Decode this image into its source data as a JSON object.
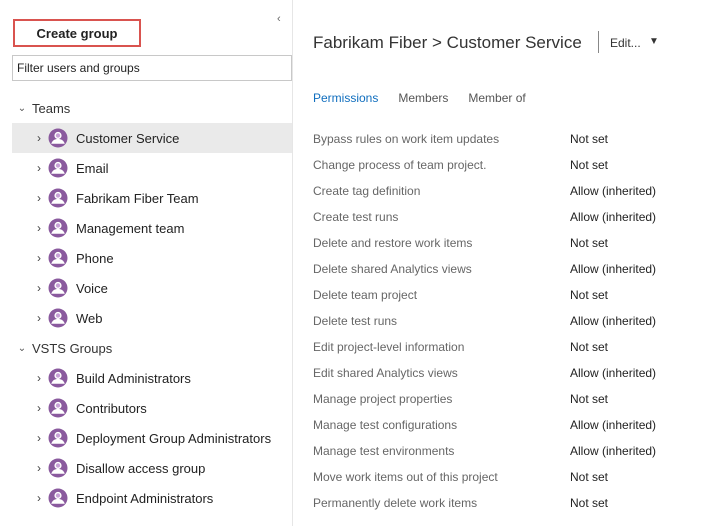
{
  "left_panel": {
    "create_group_label": "Create group",
    "collapse_glyph": "‹",
    "filter_placeholder": "Filter users and groups"
  },
  "tree": {
    "groups": [
      {
        "label": "Teams",
        "items": [
          {
            "label": "Customer Service",
            "selected": true
          },
          {
            "label": "Email"
          },
          {
            "label": "Fabrikam Fiber Team"
          },
          {
            "label": "Management team"
          },
          {
            "label": "Phone"
          },
          {
            "label": "Voice"
          },
          {
            "label": "Web"
          }
        ]
      },
      {
        "label": "VSTS Groups",
        "items": [
          {
            "label": "Build Administrators"
          },
          {
            "label": "Contributors"
          },
          {
            "label": "Deployment Group Administrators"
          },
          {
            "label": "Disallow access group"
          },
          {
            "label": "Endpoint Administrators"
          }
        ]
      }
    ]
  },
  "header": {
    "breadcrumb": "Fabrikam Fiber > Customer Service",
    "edit_label": "Edit...",
    "edit_caret": "▼"
  },
  "tabs": [
    {
      "label": "Permissions",
      "active": true
    },
    {
      "label": "Members"
    },
    {
      "label": "Member of"
    }
  ],
  "permissions": [
    {
      "name": "Bypass rules on work item updates",
      "value": "Not set"
    },
    {
      "name": "Change process of team project.",
      "value": "Not set"
    },
    {
      "name": "Create tag definition",
      "value": "Allow (inherited)"
    },
    {
      "name": "Create test runs",
      "value": "Allow (inherited)"
    },
    {
      "name": "Delete and restore work items",
      "value": "Not set"
    },
    {
      "name": "Delete shared Analytics views",
      "value": "Allow (inherited)"
    },
    {
      "name": "Delete team project",
      "value": "Not set"
    },
    {
      "name": "Delete test runs",
      "value": "Allow (inherited)"
    },
    {
      "name": "Edit project-level information",
      "value": "Not set"
    },
    {
      "name": "Edit shared Analytics views",
      "value": "Allow (inherited)"
    },
    {
      "name": "Manage project properties",
      "value": "Not set"
    },
    {
      "name": "Manage test configurations",
      "value": "Allow (inherited)"
    },
    {
      "name": "Manage test environments",
      "value": "Allow (inherited)"
    },
    {
      "name": "Move work items out of this project",
      "value": "Not set"
    },
    {
      "name": "Permanently delete work items",
      "value": "Not set"
    }
  ],
  "icons": {
    "group_icon": "group-icon",
    "chevron_right": "chevron-right-icon",
    "chevron_down": "chevron-down-icon"
  },
  "colors": {
    "accent": "#106ebe",
    "highlight_border": "#d9534f",
    "group_icon": "#8a5a9e",
    "selected_row": "#eaeaea"
  }
}
